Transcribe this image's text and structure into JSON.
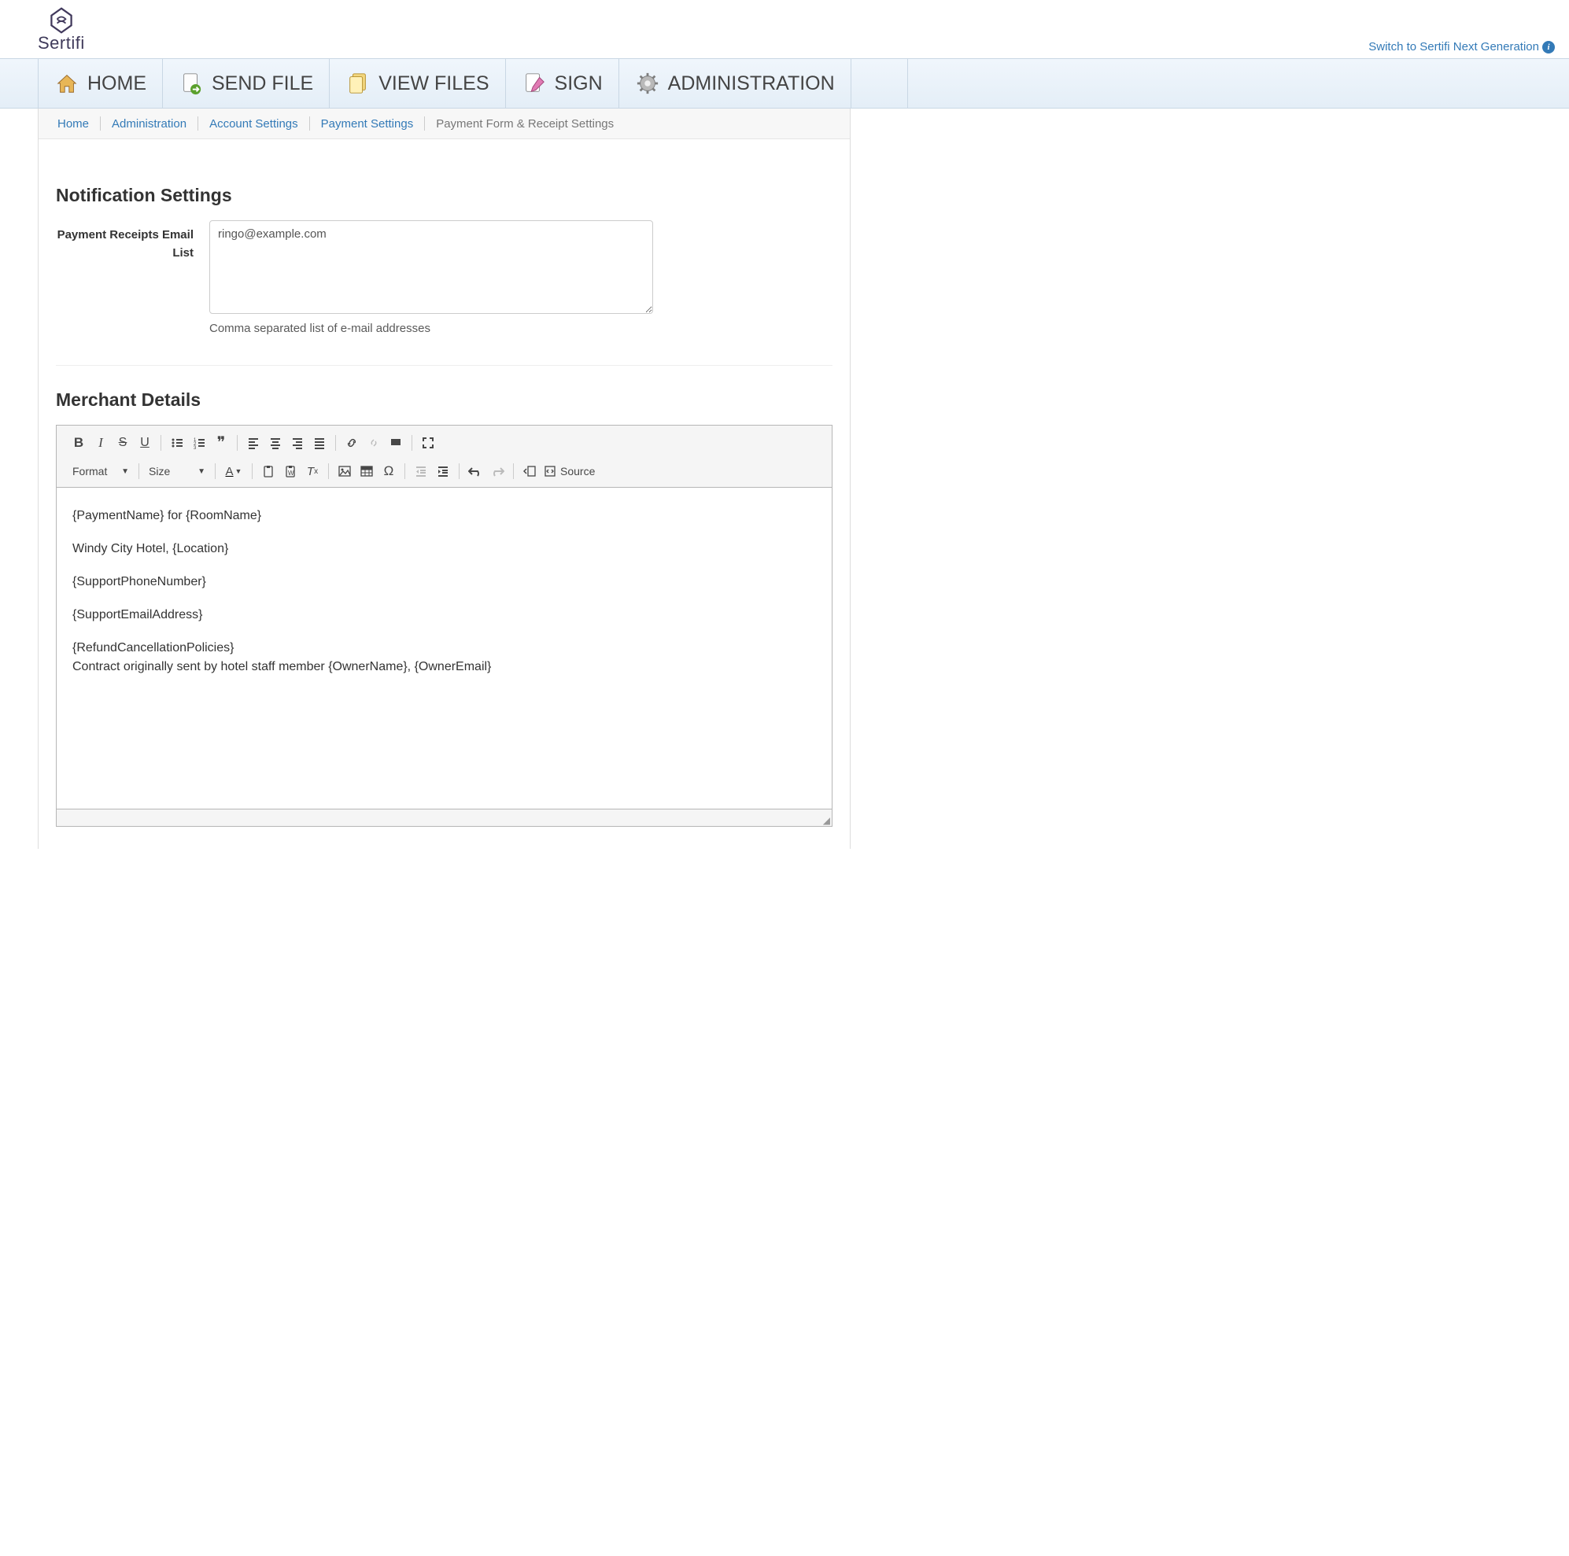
{
  "brand": "Sertifi",
  "switch_link": "Switch to Sertifi Next Generation",
  "nav": [
    {
      "label": "HOME"
    },
    {
      "label": "SEND FILE"
    },
    {
      "label": "VIEW FILES"
    },
    {
      "label": "SIGN"
    },
    {
      "label": "ADMINISTRATION"
    }
  ],
  "breadcrumb": {
    "links": [
      "Home",
      "Administration",
      "Account Settings",
      "Payment Settings"
    ],
    "current": "Payment Form & Receipt Settings"
  },
  "notif_heading": "Notification Settings",
  "email_list": {
    "label": "Payment Receipts Email List",
    "value": "ringo@example.com",
    "help": "Comma separated list of e-mail addresses"
  },
  "merchant_heading": "Merchant Details",
  "toolbar": {
    "format": "Format",
    "size": "Size",
    "source": "Source"
  },
  "editor_lines": [
    "{PaymentName} for {RoomName}",
    "Windy City Hotel, {Location}",
    "{SupportPhoneNumber}",
    "{SupportEmailAddress}",
    "{RefundCancellationPolicies}\nContract originally sent by hotel staff member {OwnerName}, {OwnerEmail}"
  ]
}
